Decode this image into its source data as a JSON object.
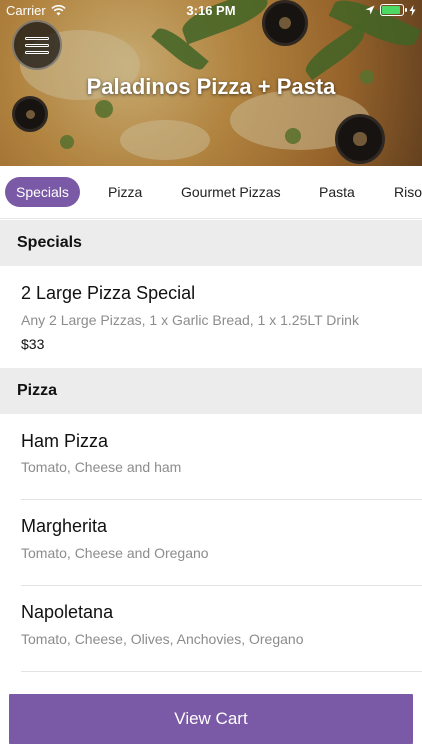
{
  "status_bar": {
    "carrier": "Carrier",
    "time": "3:16 PM"
  },
  "header": {
    "restaurant_name": "Paladinos Pizza + Pasta"
  },
  "tabs": [
    {
      "label": "Specials",
      "active": true
    },
    {
      "label": "Pizza",
      "active": false
    },
    {
      "label": "Gourmet Pizzas",
      "active": false
    },
    {
      "label": "Pasta",
      "active": false
    },
    {
      "label": "Riso",
      "active": false
    }
  ],
  "sections": [
    {
      "title": "Specials",
      "items": [
        {
          "name": "2 Large Pizza Special",
          "description": "Any 2 Large Pizzas, 1 x Garlic Bread, 1 x 1.25LT Drink",
          "price": "$33"
        }
      ]
    },
    {
      "title": "Pizza",
      "items": [
        {
          "name": "Ham Pizza",
          "description": "Tomato, Cheese and ham"
        },
        {
          "name": "Margherita",
          "description": "Tomato, Cheese and Oregano"
        },
        {
          "name": "Napoletana",
          "description": "Tomato, Cheese, Olives, Anchovies, Oregano"
        }
      ]
    }
  ],
  "cart": {
    "label": "View Cart"
  },
  "colors": {
    "accent": "#7a5aa6",
    "section_bg": "#ececec"
  }
}
